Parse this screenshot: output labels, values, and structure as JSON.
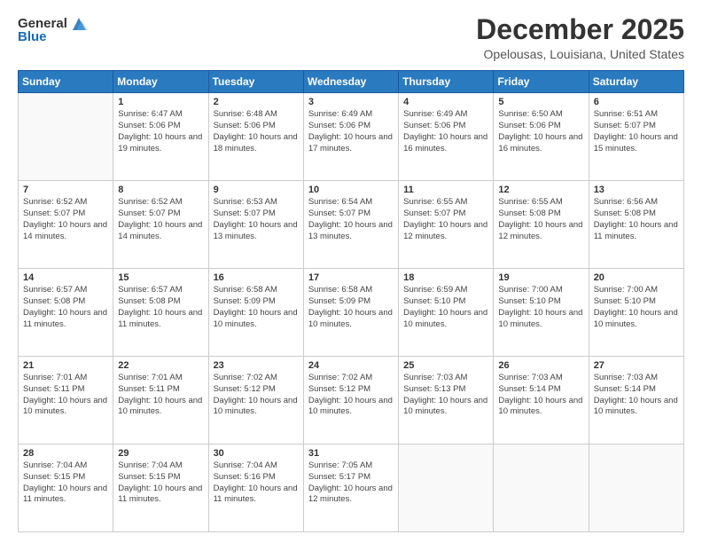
{
  "header": {
    "logo_general": "General",
    "logo_blue": "Blue",
    "month_title": "December 2025",
    "location": "Opelousas, Louisiana, United States"
  },
  "weekdays": [
    "Sunday",
    "Monday",
    "Tuesday",
    "Wednesday",
    "Thursday",
    "Friday",
    "Saturday"
  ],
  "weeks": [
    [
      {
        "day": "",
        "sunrise": "",
        "sunset": "",
        "daylight": ""
      },
      {
        "day": "1",
        "sunrise": "Sunrise: 6:47 AM",
        "sunset": "Sunset: 5:06 PM",
        "daylight": "Daylight: 10 hours and 19 minutes."
      },
      {
        "day": "2",
        "sunrise": "Sunrise: 6:48 AM",
        "sunset": "Sunset: 5:06 PM",
        "daylight": "Daylight: 10 hours and 18 minutes."
      },
      {
        "day": "3",
        "sunrise": "Sunrise: 6:49 AM",
        "sunset": "Sunset: 5:06 PM",
        "daylight": "Daylight: 10 hours and 17 minutes."
      },
      {
        "day": "4",
        "sunrise": "Sunrise: 6:49 AM",
        "sunset": "Sunset: 5:06 PM",
        "daylight": "Daylight: 10 hours and 16 minutes."
      },
      {
        "day": "5",
        "sunrise": "Sunrise: 6:50 AM",
        "sunset": "Sunset: 5:06 PM",
        "daylight": "Daylight: 10 hours and 16 minutes."
      },
      {
        "day": "6",
        "sunrise": "Sunrise: 6:51 AM",
        "sunset": "Sunset: 5:07 PM",
        "daylight": "Daylight: 10 hours and 15 minutes."
      }
    ],
    [
      {
        "day": "7",
        "sunrise": "Sunrise: 6:52 AM",
        "sunset": "Sunset: 5:07 PM",
        "daylight": "Daylight: 10 hours and 14 minutes."
      },
      {
        "day": "8",
        "sunrise": "Sunrise: 6:52 AM",
        "sunset": "Sunset: 5:07 PM",
        "daylight": "Daylight: 10 hours and 14 minutes."
      },
      {
        "day": "9",
        "sunrise": "Sunrise: 6:53 AM",
        "sunset": "Sunset: 5:07 PM",
        "daylight": "Daylight: 10 hours and 13 minutes."
      },
      {
        "day": "10",
        "sunrise": "Sunrise: 6:54 AM",
        "sunset": "Sunset: 5:07 PM",
        "daylight": "Daylight: 10 hours and 13 minutes."
      },
      {
        "day": "11",
        "sunrise": "Sunrise: 6:55 AM",
        "sunset": "Sunset: 5:07 PM",
        "daylight": "Daylight: 10 hours and 12 minutes."
      },
      {
        "day": "12",
        "sunrise": "Sunrise: 6:55 AM",
        "sunset": "Sunset: 5:08 PM",
        "daylight": "Daylight: 10 hours and 12 minutes."
      },
      {
        "day": "13",
        "sunrise": "Sunrise: 6:56 AM",
        "sunset": "Sunset: 5:08 PM",
        "daylight": "Daylight: 10 hours and 11 minutes."
      }
    ],
    [
      {
        "day": "14",
        "sunrise": "Sunrise: 6:57 AM",
        "sunset": "Sunset: 5:08 PM",
        "daylight": "Daylight: 10 hours and 11 minutes."
      },
      {
        "day": "15",
        "sunrise": "Sunrise: 6:57 AM",
        "sunset": "Sunset: 5:08 PM",
        "daylight": "Daylight: 10 hours and 11 minutes."
      },
      {
        "day": "16",
        "sunrise": "Sunrise: 6:58 AM",
        "sunset": "Sunset: 5:09 PM",
        "daylight": "Daylight: 10 hours and 10 minutes."
      },
      {
        "day": "17",
        "sunrise": "Sunrise: 6:58 AM",
        "sunset": "Sunset: 5:09 PM",
        "daylight": "Daylight: 10 hours and 10 minutes."
      },
      {
        "day": "18",
        "sunrise": "Sunrise: 6:59 AM",
        "sunset": "Sunset: 5:10 PM",
        "daylight": "Daylight: 10 hours and 10 minutes."
      },
      {
        "day": "19",
        "sunrise": "Sunrise: 7:00 AM",
        "sunset": "Sunset: 5:10 PM",
        "daylight": "Daylight: 10 hours and 10 minutes."
      },
      {
        "day": "20",
        "sunrise": "Sunrise: 7:00 AM",
        "sunset": "Sunset: 5:10 PM",
        "daylight": "Daylight: 10 hours and 10 minutes."
      }
    ],
    [
      {
        "day": "21",
        "sunrise": "Sunrise: 7:01 AM",
        "sunset": "Sunset: 5:11 PM",
        "daylight": "Daylight: 10 hours and 10 minutes."
      },
      {
        "day": "22",
        "sunrise": "Sunrise: 7:01 AM",
        "sunset": "Sunset: 5:11 PM",
        "daylight": "Daylight: 10 hours and 10 minutes."
      },
      {
        "day": "23",
        "sunrise": "Sunrise: 7:02 AM",
        "sunset": "Sunset: 5:12 PM",
        "daylight": "Daylight: 10 hours and 10 minutes."
      },
      {
        "day": "24",
        "sunrise": "Sunrise: 7:02 AM",
        "sunset": "Sunset: 5:12 PM",
        "daylight": "Daylight: 10 hours and 10 minutes."
      },
      {
        "day": "25",
        "sunrise": "Sunrise: 7:03 AM",
        "sunset": "Sunset: 5:13 PM",
        "daylight": "Daylight: 10 hours and 10 minutes."
      },
      {
        "day": "26",
        "sunrise": "Sunrise: 7:03 AM",
        "sunset": "Sunset: 5:14 PM",
        "daylight": "Daylight: 10 hours and 10 minutes."
      },
      {
        "day": "27",
        "sunrise": "Sunrise: 7:03 AM",
        "sunset": "Sunset: 5:14 PM",
        "daylight": "Daylight: 10 hours and 10 minutes."
      }
    ],
    [
      {
        "day": "28",
        "sunrise": "Sunrise: 7:04 AM",
        "sunset": "Sunset: 5:15 PM",
        "daylight": "Daylight: 10 hours and 11 minutes."
      },
      {
        "day": "29",
        "sunrise": "Sunrise: 7:04 AM",
        "sunset": "Sunset: 5:15 PM",
        "daylight": "Daylight: 10 hours and 11 minutes."
      },
      {
        "day": "30",
        "sunrise": "Sunrise: 7:04 AM",
        "sunset": "Sunset: 5:16 PM",
        "daylight": "Daylight: 10 hours and 11 minutes."
      },
      {
        "day": "31",
        "sunrise": "Sunrise: 7:05 AM",
        "sunset": "Sunset: 5:17 PM",
        "daylight": "Daylight: 10 hours and 12 minutes."
      },
      {
        "day": "",
        "sunrise": "",
        "sunset": "",
        "daylight": ""
      },
      {
        "day": "",
        "sunrise": "",
        "sunset": "",
        "daylight": ""
      },
      {
        "day": "",
        "sunrise": "",
        "sunset": "",
        "daylight": ""
      }
    ]
  ]
}
